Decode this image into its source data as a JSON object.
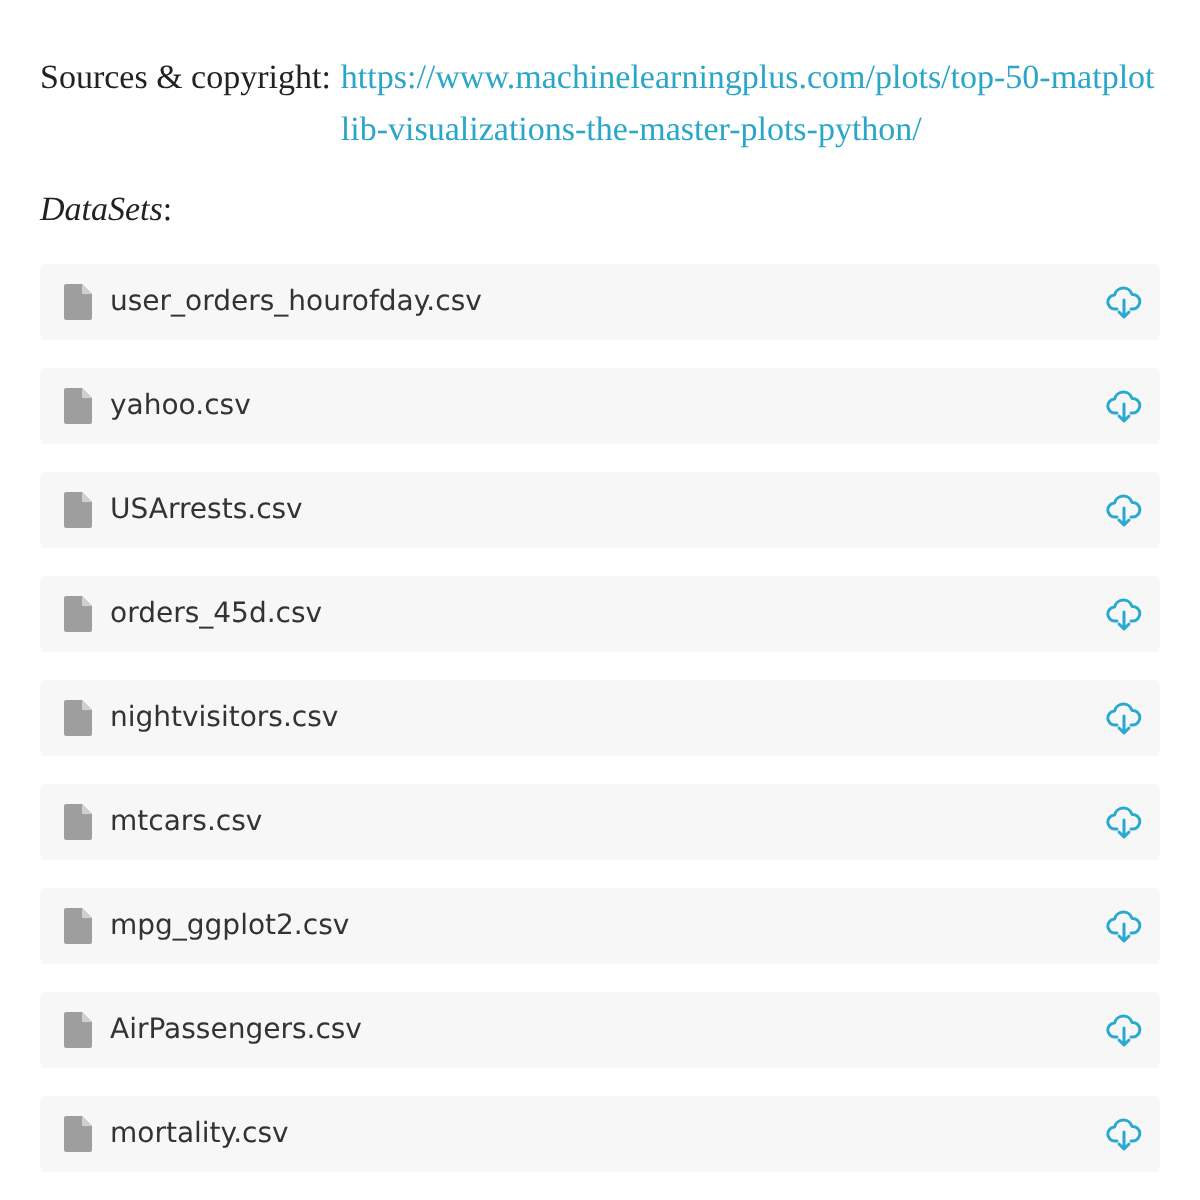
{
  "sources": {
    "label": "Sources & copyright:",
    "link": "https://www.machinelearningplus.com/plots/top-50-matplotlib-visualizations-the-master-plots-python/"
  },
  "datasets_heading": {
    "title": "DataSets",
    "suffix": ":"
  },
  "files": [
    {
      "name": "user_orders_hourofday.csv"
    },
    {
      "name": "yahoo.csv"
    },
    {
      "name": "USArrests.csv"
    },
    {
      "name": "orders_45d.csv"
    },
    {
      "name": "nightvisitors.csv"
    },
    {
      "name": "mtcars.csv"
    },
    {
      "name": "mpg_ggplot2.csv"
    },
    {
      "name": "AirPassengers.csv"
    },
    {
      "name": "mortality.csv"
    }
  ]
}
